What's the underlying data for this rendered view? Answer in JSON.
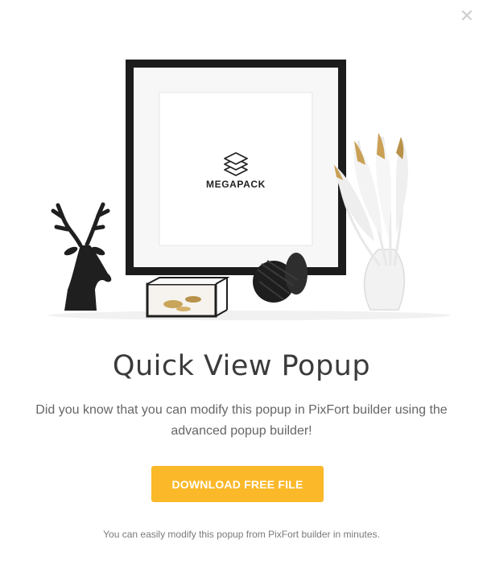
{
  "popup": {
    "close_icon": "close-icon",
    "hero_image": {
      "frame_label": "MEGAPACK",
      "logo_icon": "stacked-layers-icon",
      "objects": [
        "deer-head-figurine",
        "glass-jewelry-box",
        "black-twine-spool",
        "picture-frame",
        "feathers-in-glass-vase"
      ]
    },
    "title": "Quick View Popup",
    "description": "Did you know that you can modify this popup in PixFort builder using the advanced popup builder!",
    "cta_label": "DOWNLOAD FREE FILE",
    "footnote": "You can easily modify this popup from PixFort builder in minutes."
  },
  "colors": {
    "accent": "#fbb829",
    "title": "#3b3b3b",
    "text": "#666666",
    "close": "#cfcfcf"
  }
}
